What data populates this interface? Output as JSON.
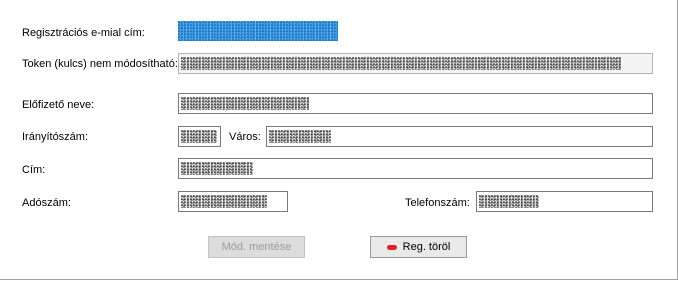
{
  "form": {
    "email_label": "Regisztrációs e-mial cím:",
    "token_label": "Token (kulcs) nem módosítható:",
    "subscriber_label": "Előfizető neve:",
    "zip_label": "Irányítószám:",
    "city_label": "Város:",
    "address_label": "Cím:",
    "tax_label": "Adószám:",
    "phone_label": "Telefonszám:"
  },
  "buttons": {
    "save_label": "Mód. mentése",
    "delete_label": "Reg. töröl"
  },
  "colors": {
    "redact_blue": "#4ea8e0",
    "delete_icon": "#e0202a"
  }
}
